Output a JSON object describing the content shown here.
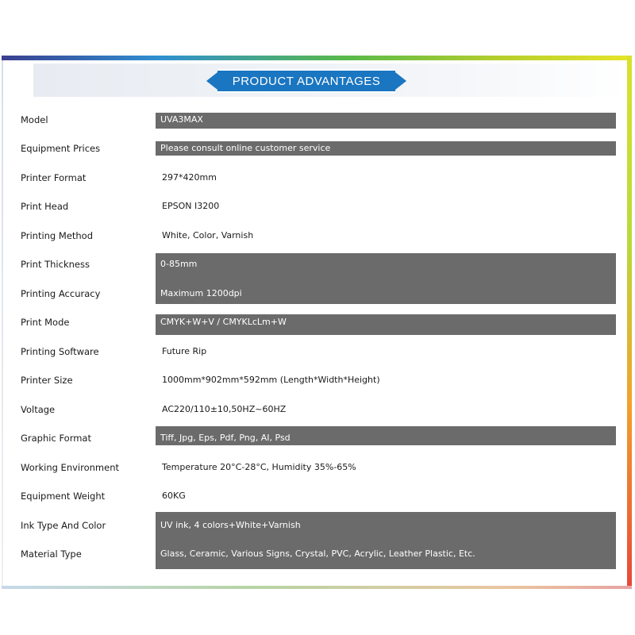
{
  "header": {
    "title": "PRODUCT ADVANTAGES"
  },
  "specs": [
    {
      "label": "Model",
      "value": "UVA3MAX"
    },
    {
      "label": "Equipment Prices",
      "value": "Please consult online customer service"
    },
    {
      "label": "Printer Format",
      "value": "297*420mm"
    },
    {
      "label": "Print Head",
      "value": "EPSON I3200"
    },
    {
      "label": "Printing Method",
      "value": "White, Color, Varnish"
    },
    {
      "label": "Print Thickness",
      "value": "0-85mm"
    },
    {
      "label": "Printing Accuracy",
      "value": "Maximum 1200dpi"
    },
    {
      "label": "Print Mode",
      "value": "CMYK+W+V / CMYKLcLm+W"
    },
    {
      "label": "Printing Software",
      "value": "Future Rip"
    },
    {
      "label": "Printer Size",
      "value": "1000mm*902mm*592mm (Length*Width*Height)"
    },
    {
      "label": "Voltage",
      "value": "AC220/110±10,50HZ~60HZ"
    },
    {
      "label": "Graphic Format",
      "value": "Tiff, Jpg, Eps, Pdf, Png, AI, Psd"
    },
    {
      "label": "Working Environment",
      "value": "Temperature 20°C-28°C, Humidity 35%-65%"
    },
    {
      "label": "Equipment Weight",
      "value": "60KG"
    },
    {
      "label": "Ink Type And Color",
      "value": "UV ink, 4 colors+White+Varnish"
    },
    {
      "label": "Material Type",
      "value": "Glass, Ceramic, Various Signs, Crystal, PVC, Acrylic, Leather Plastic, Etc."
    }
  ],
  "colors": {
    "banner": "#1b76c1",
    "dark_row": "#6b6b6b"
  }
}
